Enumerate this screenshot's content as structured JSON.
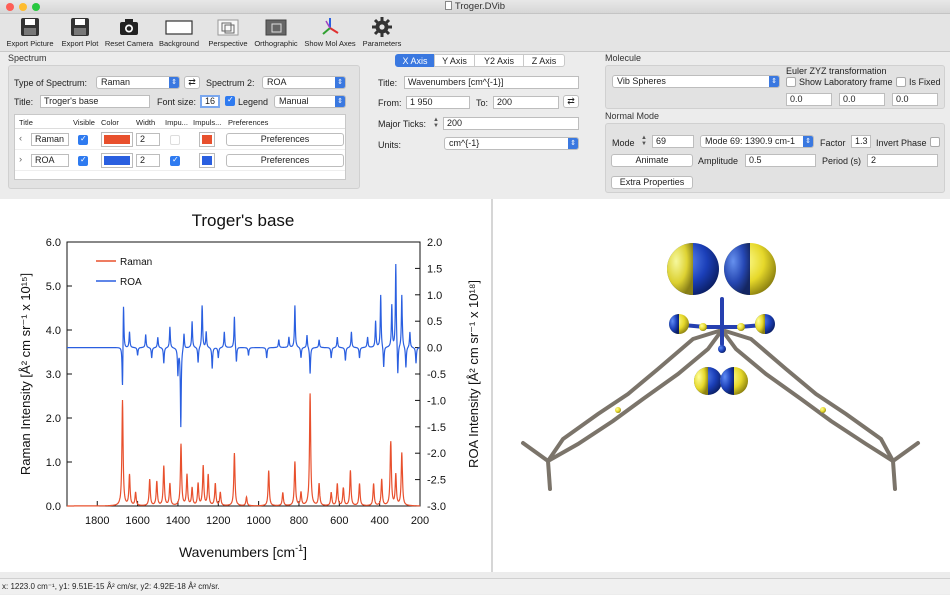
{
  "window": {
    "title": "Troger.DVib"
  },
  "toolbar": {
    "items": [
      {
        "label": "Export Picture",
        "icon": "floppy-icon"
      },
      {
        "label": "Export Plot",
        "icon": "floppy-icon"
      },
      {
        "label": "Reset Camera",
        "icon": "camera-icon"
      },
      {
        "label": "Background",
        "icon": "rectangle-icon"
      },
      {
        "label": "Perspective",
        "icon": "perspective-icon"
      },
      {
        "label": "Orthographic",
        "icon": "orthographic-icon"
      },
      {
        "label": "Show Mol Axes",
        "icon": "axes-icon"
      },
      {
        "label": "Parameters",
        "icon": "gear-icon"
      }
    ]
  },
  "spectrum": {
    "section": "Spectrum",
    "type_label": "Type of Spectrum:",
    "type_value": "Raman",
    "spec2_label": "Spectrum 2:",
    "spec2_value": "ROA",
    "title_label": "Title:",
    "title_value": "Troger's base",
    "fontsize_label": "Font size:",
    "fontsize_value": "16",
    "legend_label": "Legend",
    "legend_mode": "Manual",
    "columns": [
      "Title",
      "Visible",
      "Color",
      "Width",
      "Impu...",
      "Impuls...",
      "Preferences"
    ],
    "rows": [
      {
        "title": "Raman",
        "color": "#e8502d",
        "width": "2",
        "impulse_color": "#e8502d",
        "pref": "Preferences",
        "visible": true,
        "impulse": false
      },
      {
        "title": "ROA",
        "color": "#2a5fe0",
        "width": "2",
        "impulse_color": "#2a5fe0",
        "pref": "Preferences",
        "visible": true,
        "impulse": true
      }
    ]
  },
  "axis": {
    "tabs": [
      "X Axis",
      "Y Axis",
      "Y2 Axis",
      "Z Axis"
    ],
    "title_label": "Title:",
    "title_value": "Wavenumbers [cm^{-1}]",
    "from_label": "From:",
    "from_value": "1 950",
    "to_label": "To:",
    "to_value": "200",
    "ticks_label": "Major Ticks:",
    "ticks_value": "200",
    "units_label": "Units:",
    "units_value": "cm^{-1}"
  },
  "molecule": {
    "section": "Molecule",
    "rep_value": "Vib Spheres",
    "euler_label": "Euler ZYZ transformation",
    "show_lab_label": "Show Laboratory frame",
    "fixed_label": "Is Fixed",
    "euler": [
      "0.0",
      "0.0",
      "0.0"
    ]
  },
  "normal_mode": {
    "section": "Normal Mode",
    "mode_label": "Mode",
    "mode_value": "69",
    "mode_select": "Mode  69: 1390.9 cm-1",
    "factor_label": "Factor",
    "factor_value": "1.3",
    "invert_label": "Invert Phase",
    "animate_label": "Animate",
    "amplitude_label": "Amplitude",
    "amplitude_value": "0.5",
    "period_label": "Period (s)",
    "period_value": "2",
    "extra_label": "Extra Properties"
  },
  "chart_data": {
    "type": "line",
    "title": "Troger's base",
    "xlabel": "Wavenumbers [cm",
    "xlabel_sup": "-1",
    "xlabel_end": "]",
    "ylabel": "Raman Intensity [Å² cm sr⁻¹ x 10¹⁵]",
    "y2label": "ROA Intensity [Å² cm sr⁻¹ x 10¹⁸]",
    "xlim": [
      1950,
      200
    ],
    "ylim": [
      0,
      6
    ],
    "y2lim": [
      -3,
      2
    ],
    "xticks": [
      1800,
      1600,
      1400,
      1200,
      1000,
      800,
      600,
      400,
      200
    ],
    "yticks": [
      0.0,
      1.0,
      2.0,
      3.0,
      4.0,
      5.0,
      6.0
    ],
    "y2ticks": [
      -3.0,
      -2.5,
      -2.0,
      -1.5,
      -1.0,
      -0.5,
      0.0,
      0.5,
      1.0,
      1.5,
      2.0
    ],
    "legend": [
      "Raman",
      "ROA"
    ],
    "colors": [
      "#e8502d",
      "#2a5fe0"
    ],
    "series": [
      {
        "name": "Raman",
        "axis": "y",
        "peaks": [
          [
            1675,
            2.4
          ],
          [
            1640,
            0.7
          ],
          [
            1610,
            0.3
          ],
          [
            1540,
            0.6
          ],
          [
            1505,
            0.55
          ],
          [
            1470,
            0.9
          ],
          [
            1440,
            0.5
          ],
          [
            1385,
            1.4
          ],
          [
            1355,
            0.7
          ],
          [
            1330,
            0.4
          ],
          [
            1300,
            0.5
          ],
          [
            1275,
            0.9
          ],
          [
            1250,
            0.7
          ],
          [
            1215,
            0.5
          ],
          [
            1190,
            0.3
          ],
          [
            1120,
            1.2
          ],
          [
            1060,
            0.2
          ],
          [
            950,
            0.8
          ],
          [
            880,
            0.3
          ],
          [
            820,
            1.0
          ],
          [
            790,
            0.3
          ],
          [
            745,
            2.55
          ],
          [
            700,
            0.5
          ],
          [
            640,
            0.3
          ],
          [
            610,
            0.5
          ],
          [
            580,
            0.4
          ],
          [
            545,
            0.8
          ],
          [
            500,
            0.5
          ],
          [
            430,
            0.5
          ],
          [
            390,
            0.6
          ],
          [
            345,
            1.45
          ],
          [
            320,
            0.7
          ],
          [
            290,
            1.2
          ]
        ]
      },
      {
        "name": "ROA",
        "axis": "y2",
        "peaks": [
          [
            1675,
            -0.9
          ],
          [
            1670,
            0.95
          ],
          [
            1640,
            0.3
          ],
          [
            1600,
            -0.15
          ],
          [
            1560,
            0.25
          ],
          [
            1530,
            -0.2
          ],
          [
            1500,
            0.2
          ],
          [
            1470,
            -0.3
          ],
          [
            1440,
            0.4
          ],
          [
            1400,
            -0.5
          ],
          [
            1386,
            -1.5
          ],
          [
            1370,
            0.3
          ],
          [
            1330,
            0.5
          ],
          [
            1300,
            -0.3
          ],
          [
            1280,
            0.8
          ],
          [
            1260,
            0.3
          ],
          [
            1230,
            -0.4
          ],
          [
            1200,
            -0.2
          ],
          [
            1170,
            0.3
          ],
          [
            1120,
            0.6
          ],
          [
            1110,
            -0.3
          ],
          [
            1050,
            -0.15
          ],
          [
            960,
            -0.2
          ],
          [
            900,
            0.15
          ],
          [
            850,
            0.2
          ],
          [
            820,
            0.8
          ],
          [
            790,
            -0.2
          ],
          [
            760,
            0.25
          ],
          [
            745,
            -0.5
          ],
          [
            700,
            0.15
          ],
          [
            640,
            -0.2
          ],
          [
            610,
            0.2
          ],
          [
            570,
            -0.25
          ],
          [
            540,
            0.3
          ],
          [
            500,
            -0.2
          ],
          [
            460,
            0.2
          ],
          [
            420,
            0.5
          ],
          [
            395,
            1.0
          ],
          [
            380,
            -0.4
          ],
          [
            340,
            0.8
          ],
          [
            320,
            1.6
          ],
          [
            310,
            -0.6
          ],
          [
            290,
            1.0
          ],
          [
            270,
            -0.4
          ],
          [
            250,
            0.3
          ],
          [
            220,
            -0.3
          ]
        ]
      }
    ]
  },
  "status": {
    "text": "x: 1223.0 cm⁻¹,  y1: 9.51E-15 Å² cm/sr,  y2: 4.92E-18 Å² cm/sr."
  }
}
